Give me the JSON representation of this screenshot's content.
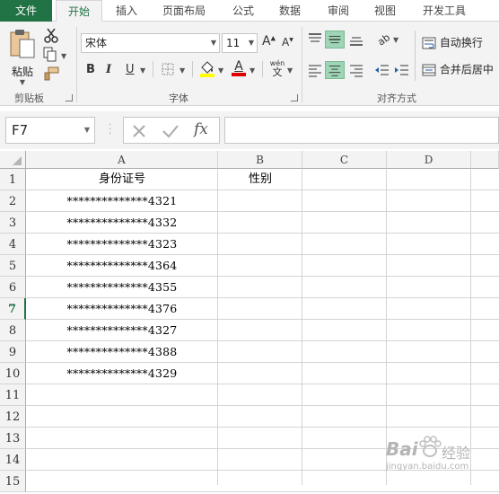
{
  "tabs": [
    {
      "label": "文件"
    },
    {
      "label": "开始"
    },
    {
      "label": "插入"
    },
    {
      "label": "页面布局"
    },
    {
      "label": "公式"
    },
    {
      "label": "数据"
    },
    {
      "label": "审阅"
    },
    {
      "label": "视图"
    },
    {
      "label": "开发工具"
    }
  ],
  "ribbon": {
    "clipboard": {
      "label": "剪贴板",
      "paste": "粘贴"
    },
    "font": {
      "label": "字体",
      "name": "宋体",
      "size": "11",
      "bold": "B",
      "italic": "I",
      "underline": "U",
      "grow": "A",
      "shrink": "A",
      "phonetic_top": "wén",
      "phonetic_bottom": "文",
      "font_color": "A"
    },
    "alignment": {
      "label": "对齐方式",
      "wrap": "自动换行",
      "merge": "合并后居中"
    }
  },
  "formula_bar": {
    "name_box": "F7",
    "fx": "fx",
    "value": ""
  },
  "sheet": {
    "columns": [
      "A",
      "B",
      "C",
      "D"
    ],
    "rows": [
      {
        "num": "1",
        "a": "身份证号",
        "b": "性别"
      },
      {
        "num": "2",
        "a": "**************4321",
        "b": ""
      },
      {
        "num": "3",
        "a": "**************4332",
        "b": ""
      },
      {
        "num": "4",
        "a": "**************4323",
        "b": ""
      },
      {
        "num": "5",
        "a": "**************4364",
        "b": ""
      },
      {
        "num": "6",
        "a": "**************4355",
        "b": ""
      },
      {
        "num": "7",
        "a": "**************4376",
        "b": ""
      },
      {
        "num": "8",
        "a": "**************4327",
        "b": ""
      },
      {
        "num": "9",
        "a": "**************4388",
        "b": ""
      },
      {
        "num": "10",
        "a": "**************4329",
        "b": ""
      },
      {
        "num": "11",
        "a": "",
        "b": ""
      },
      {
        "num": "12",
        "a": "",
        "b": ""
      },
      {
        "num": "13",
        "a": "",
        "b": ""
      },
      {
        "num": "14",
        "a": "",
        "b": ""
      },
      {
        "num": "15",
        "a": "",
        "b": ""
      }
    ],
    "active_row": "7"
  },
  "watermark": {
    "brand": "Bai",
    "sub": "经验",
    "url": "jingyan.baidu.com"
  },
  "colors": {
    "excel_green": "#217346",
    "selected_fill": "#9fd5b7",
    "font_red": "#e00000",
    "highlight_yellow": "#ffff00"
  }
}
